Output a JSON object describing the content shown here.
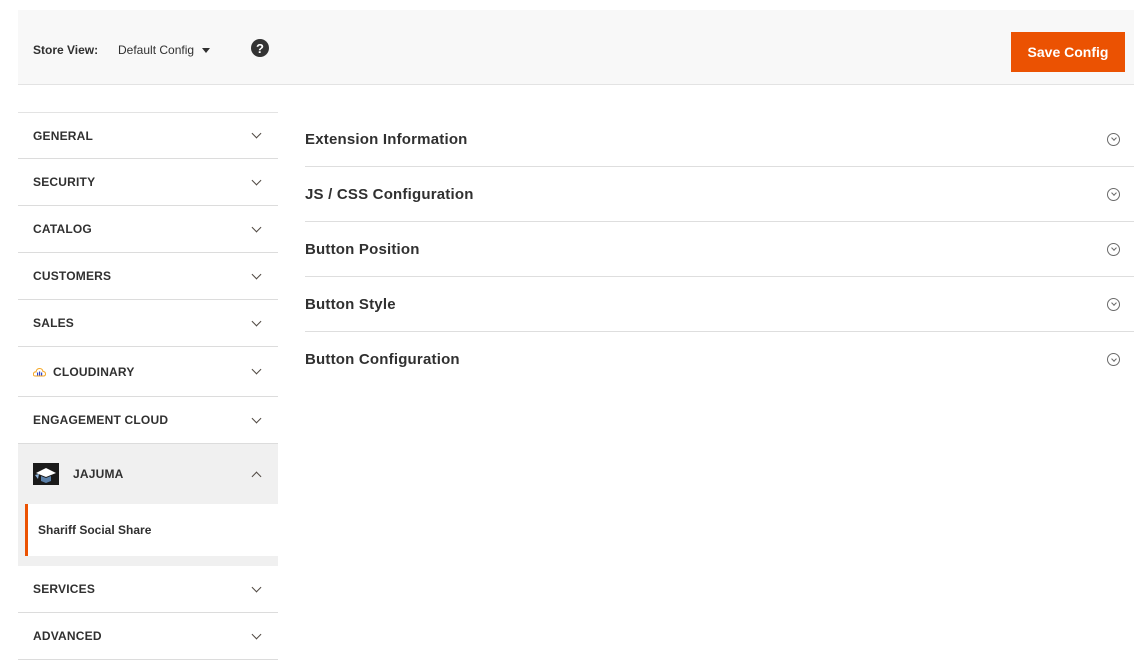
{
  "store_bar": {
    "label": "Store View:",
    "selected": "Default Config",
    "help": "?",
    "save_label": "Save Config"
  },
  "colors": {
    "accent": "#eb5202",
    "sidebar_active_bg": "#f0f0f0"
  },
  "sidebar": {
    "items": [
      {
        "label": "GENERAL",
        "icon": "chevron-down-icon"
      },
      {
        "label": "SECURITY",
        "icon": "chevron-down-icon"
      },
      {
        "label": "CATALOG",
        "icon": "chevron-down-icon"
      },
      {
        "label": "CUSTOMERS",
        "icon": "chevron-down-icon"
      },
      {
        "label": "SALES",
        "icon": "chevron-down-icon"
      },
      {
        "label": "CLOUDINARY",
        "icon": "chevron-down-icon",
        "logo": "cloudinary-logo-icon"
      },
      {
        "label": "ENGAGEMENT CLOUD",
        "icon": "chevron-down-icon"
      },
      {
        "label": "JAJUMA",
        "icon": "chevron-up-icon",
        "logo": "jajuma-logo-icon",
        "expanded": true
      },
      {
        "label": "SERVICES",
        "icon": "chevron-down-icon"
      },
      {
        "label": "ADVANCED",
        "icon": "chevron-down-icon"
      }
    ],
    "sub_items": [
      {
        "label": "Shariff Social Share",
        "active": true
      }
    ]
  },
  "main": {
    "sections": [
      {
        "title": "Extension Information",
        "icon": "circle-chevron-down-icon"
      },
      {
        "title": "JS / CSS Configuration",
        "icon": "circle-chevron-down-icon"
      },
      {
        "title": "Button Position",
        "icon": "circle-chevron-down-icon"
      },
      {
        "title": "Button Style",
        "icon": "circle-chevron-down-icon"
      },
      {
        "title": "Button Configuration",
        "icon": "circle-chevron-down-icon"
      }
    ]
  }
}
